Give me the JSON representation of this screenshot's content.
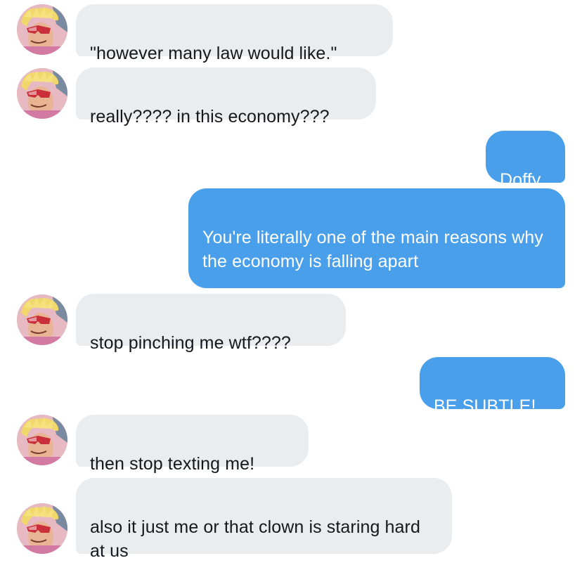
{
  "messages": [
    {
      "side": "in",
      "text": "\"however many law would like.\""
    },
    {
      "side": "in",
      "text": "really???? in this economy???"
    },
    {
      "side": "out",
      "text": "Doffy"
    },
    {
      "side": "out",
      "text": "You're literally one of the main reasons why the economy is falling apart"
    },
    {
      "side": "in",
      "text": "stop pinching me wtf????"
    },
    {
      "side": "out",
      "text": "BE SUBTLE!"
    },
    {
      "side": "in",
      "text": "then stop texting me!"
    },
    {
      "side": "in",
      "text": "also it just me or that clown is staring hard at us"
    }
  ],
  "colors": {
    "incoming_bubble": "#e9edf0",
    "outgoing_bubble": "#4a9fea",
    "incoming_text": "#15181c",
    "outgoing_text": "#ffffff"
  },
  "avatar_icon": "anime-character-avatar-icon"
}
